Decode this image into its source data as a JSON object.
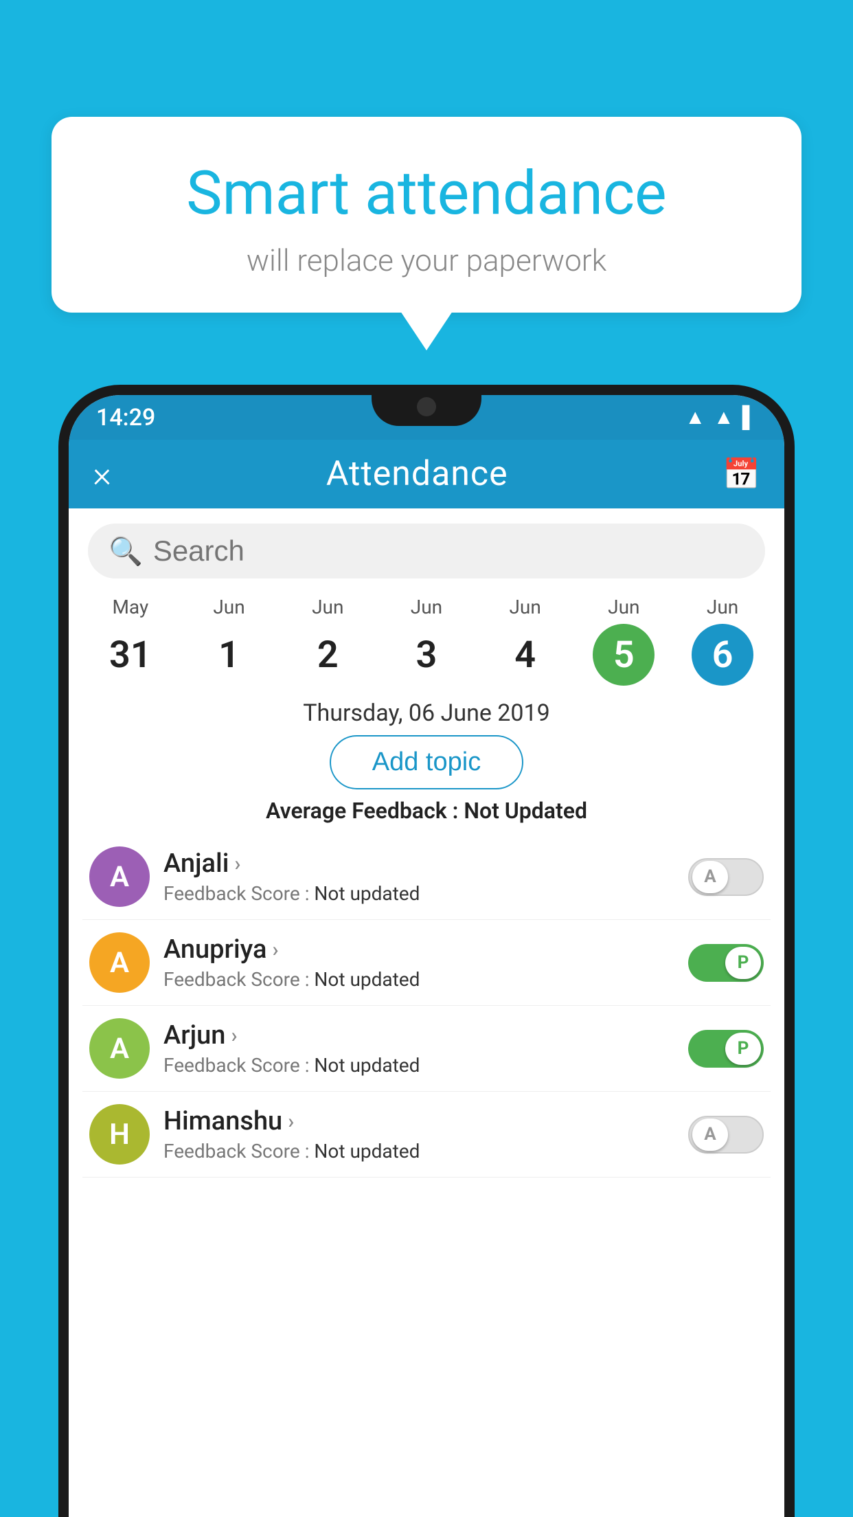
{
  "background": {
    "color": "#19b5e0"
  },
  "speech_bubble": {
    "title": "Smart attendance",
    "subtitle": "will replace your paperwork"
  },
  "status_bar": {
    "time": "14:29",
    "icons": [
      "wifi",
      "signal",
      "battery"
    ]
  },
  "header": {
    "close_label": "×",
    "title": "Attendance",
    "calendar_icon": "📅"
  },
  "search": {
    "placeholder": "Search"
  },
  "calendar": {
    "days": [
      {
        "month": "May",
        "num": "31",
        "style": "normal"
      },
      {
        "month": "Jun",
        "num": "1",
        "style": "normal"
      },
      {
        "month": "Jun",
        "num": "2",
        "style": "normal"
      },
      {
        "month": "Jun",
        "num": "3",
        "style": "normal"
      },
      {
        "month": "Jun",
        "num": "4",
        "style": "normal"
      },
      {
        "month": "Jun",
        "num": "5",
        "style": "green"
      },
      {
        "month": "Jun",
        "num": "6",
        "style": "blue"
      }
    ]
  },
  "selected_date": "Thursday, 06 June 2019",
  "add_topic_label": "Add topic",
  "average_feedback": {
    "label": "Average Feedback : ",
    "value": "Not Updated"
  },
  "students": [
    {
      "name": "Anjali",
      "avatar_letter": "A",
      "avatar_color": "#9c5fb5",
      "score_label": "Feedback Score : ",
      "score_value": "Not updated",
      "toggle_state": "off",
      "toggle_label": "A"
    },
    {
      "name": "Anupriya",
      "avatar_letter": "A",
      "avatar_color": "#f5a623",
      "score_label": "Feedback Score : ",
      "score_value": "Not updated",
      "toggle_state": "on",
      "toggle_label": "P"
    },
    {
      "name": "Arjun",
      "avatar_letter": "A",
      "avatar_color": "#8bc34a",
      "score_label": "Feedback Score : ",
      "score_value": "Not updated",
      "toggle_state": "on",
      "toggle_label": "P"
    },
    {
      "name": "Himanshu",
      "avatar_letter": "H",
      "avatar_color": "#aab830",
      "score_label": "Feedback Score : ",
      "score_value": "Not updated",
      "toggle_state": "off",
      "toggle_label": "A"
    }
  ]
}
